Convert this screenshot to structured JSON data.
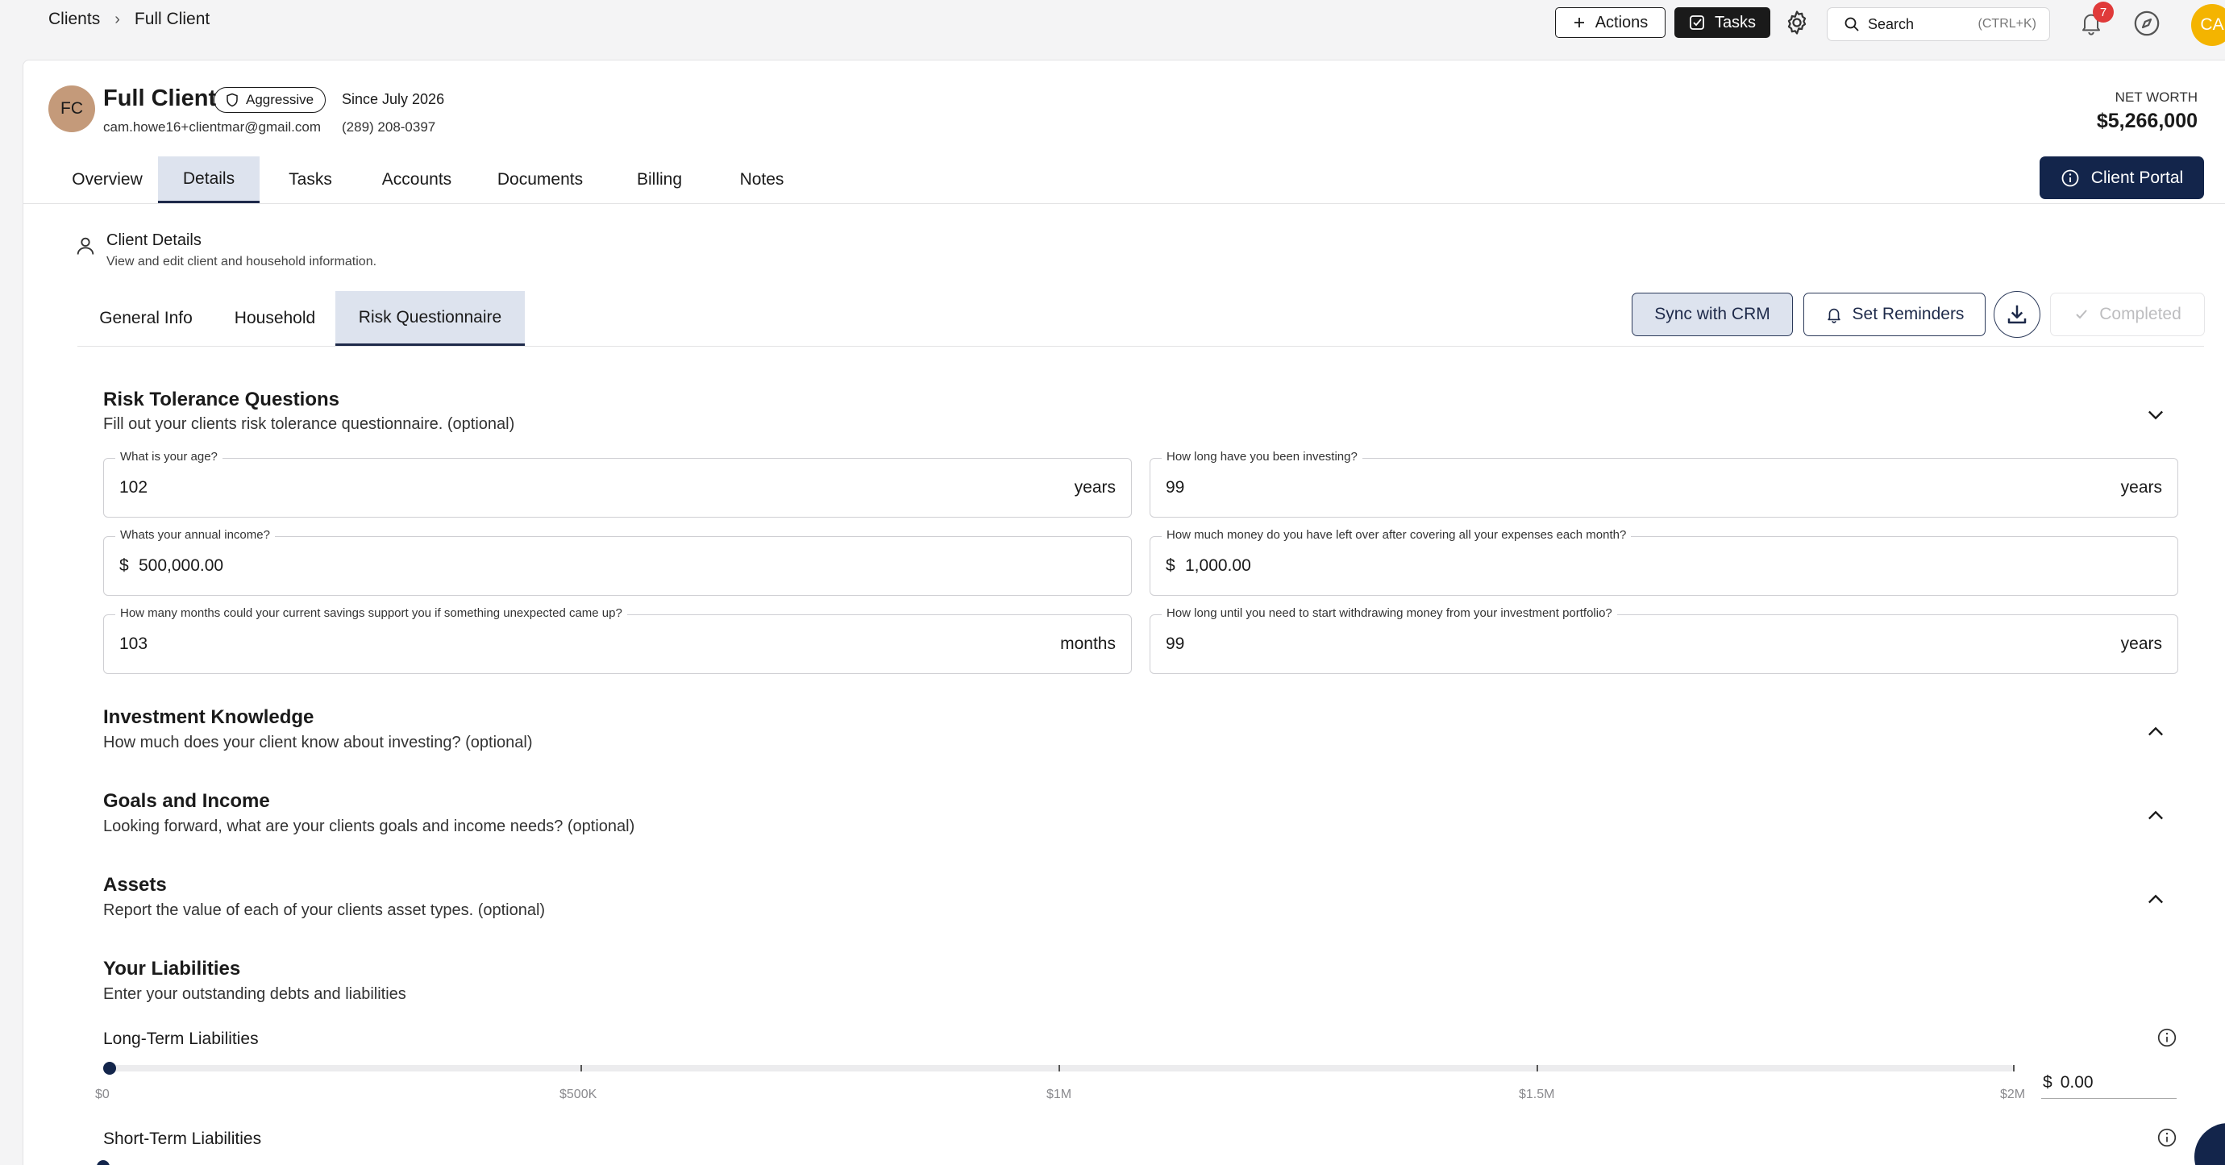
{
  "breadcrumb": {
    "root": "Clients",
    "separator": "›",
    "current": "Full Client"
  },
  "topbar": {
    "actions_label": "Actions",
    "tasks_label": "Tasks",
    "search_label": "Search",
    "search_shortcut": "(CTRL+K)",
    "notification_count": "7",
    "user_initials": "CA"
  },
  "client": {
    "initials": "FC",
    "name": "Full Client",
    "risk_profile": "Aggressive",
    "since": "Since July 2026",
    "email": "cam.howe16+clientmar@gmail.com",
    "phone": "(289) 208-0397",
    "net_worth_label": "NET WORTH",
    "net_worth_value": "$5,266,000"
  },
  "main_tabs": [
    {
      "label": "Overview",
      "active": false
    },
    {
      "label": "Details",
      "active": true
    },
    {
      "label": "Tasks",
      "active": false
    },
    {
      "label": "Accounts",
      "active": false
    },
    {
      "label": "Documents",
      "active": false
    },
    {
      "label": "Billing",
      "active": false
    },
    {
      "label": "Notes",
      "active": false
    }
  ],
  "portal_button": "Client Portal",
  "section": {
    "title": "Client Details",
    "subtitle": "View and edit client and household information."
  },
  "sub_tabs": [
    {
      "label": "General Info",
      "active": false
    },
    {
      "label": "Household",
      "active": false
    },
    {
      "label": "Risk Questionnaire",
      "active": true
    }
  ],
  "toolbar": {
    "sync_label": "Sync with CRM",
    "reminders_label": "Set Reminders",
    "completed_label": "Completed"
  },
  "risk_tolerance": {
    "title": "Risk Tolerance Questions",
    "subtitle": "Fill out your clients risk tolerance questionnaire. (optional)",
    "fields": {
      "age": {
        "label": "What is your age?",
        "value": "102",
        "suffix": "years"
      },
      "investing_years": {
        "label": "How long have you been investing?",
        "value": "99",
        "suffix": "years"
      },
      "annual_income": {
        "label": "Whats your annual income?",
        "prefix": "$",
        "value": "500,000.00"
      },
      "monthly_leftover": {
        "label": "How much money do you have left over after covering all your expenses each month?",
        "prefix": "$",
        "value": "1,000.00"
      },
      "savings_months": {
        "label": "How many months could your current savings support you if something unexpected came up?",
        "value": "103",
        "suffix": "months"
      },
      "withdraw_years": {
        "label": "How long until you need to start withdrawing money from your investment portfolio?",
        "value": "99",
        "suffix": "years"
      }
    }
  },
  "investment_knowledge": {
    "title": "Investment Knowledge",
    "subtitle": "How much does your client know about investing? (optional)"
  },
  "goals_income": {
    "title": "Goals and Income",
    "subtitle": "Looking forward, what are your clients goals and income needs? (optional)"
  },
  "assets": {
    "title": "Assets",
    "subtitle": "Report the value of each of your clients asset types. (optional)"
  },
  "liabilities": {
    "title": "Your Liabilities",
    "subtitle": "Enter your outstanding debts and liabilities",
    "long_term": {
      "label": "Long-Term Liabilities",
      "value": 0,
      "max": 2000000,
      "input_prefix": "$",
      "input_value": "0.00",
      "ticks": [
        "$0",
        "$500K",
        "$1M",
        "$1.5M",
        "$2M"
      ]
    },
    "short_term": {
      "label": "Short-Term Liabilities"
    }
  }
}
